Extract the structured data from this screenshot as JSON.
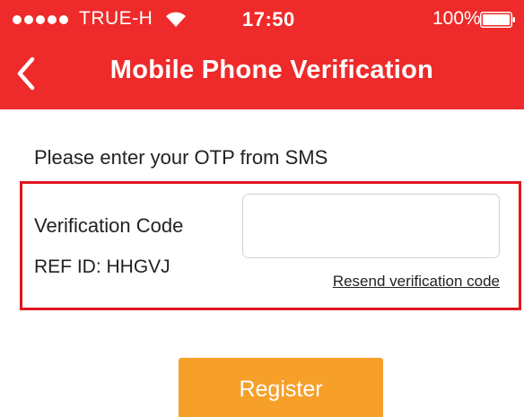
{
  "status_bar": {
    "carrier": "TRUE-H",
    "time": "17:50",
    "battery_percent": "100%",
    "signal_bars": 5,
    "wifi_icon": "wifi-icon",
    "battery_icon": "battery-icon"
  },
  "nav": {
    "back_icon": "chevron-left-icon",
    "title": "Mobile Phone Verification"
  },
  "form": {
    "prompt": "Please enter your OTP from SMS",
    "code_label": "Verification Code",
    "code_value": "",
    "ref_id": "REF ID: HHGVJ",
    "resend_label": "Resend verification code",
    "submit_label": "Register"
  },
  "colors": {
    "header": "#ee2a2a",
    "highlight_border": "#e1161e",
    "button": "#f6a02a"
  }
}
